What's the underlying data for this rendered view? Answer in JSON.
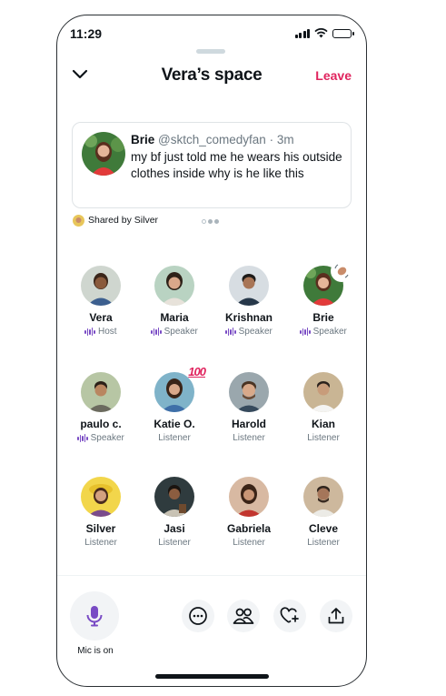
{
  "status_bar": {
    "time": "11:29"
  },
  "header": {
    "title": "Vera’s space",
    "leave_label": "Leave"
  },
  "pinned_tweet": {
    "author": "Brie",
    "handle": "@sktch_comedyfan",
    "dot": "·",
    "time": "3m",
    "text": "my bf just told me he wears his outside clothes inside why is he like this"
  },
  "shared_by": "Shared by Silver",
  "participants": [
    {
      "name": "Vera",
      "role": "Host"
    },
    {
      "name": "Maria",
      "role": "Speaker"
    },
    {
      "name": "Krishnan",
      "role": "Speaker"
    },
    {
      "name": "Brie",
      "role": "Speaker"
    },
    {
      "name": "paulo c.",
      "role": "Speaker"
    },
    {
      "name": "Katie O.",
      "role": "Listener"
    },
    {
      "name": "Harold",
      "role": "Listener"
    },
    {
      "name": "Kian",
      "role": "Listener"
    },
    {
      "name": "Silver",
      "role": "Listener"
    },
    {
      "name": "Jasi",
      "role": "Listener"
    },
    {
      "name": "Gabriela",
      "role": "Listener"
    },
    {
      "name": "Cleve",
      "role": "Listener"
    }
  ],
  "reactions": {
    "katie": "100"
  },
  "footer": {
    "mic_label": "Mic is on"
  },
  "colors": {
    "accent_purple": "#794bc4",
    "leave_red": "#e0245e",
    "text_secondary": "#6b7780"
  },
  "icons": [
    "chevron-down-icon",
    "mic-icon",
    "more-icon",
    "people-icon",
    "heart-plus-icon",
    "share-icon",
    "wave-hand-icon",
    "audio-wave-icon"
  ]
}
